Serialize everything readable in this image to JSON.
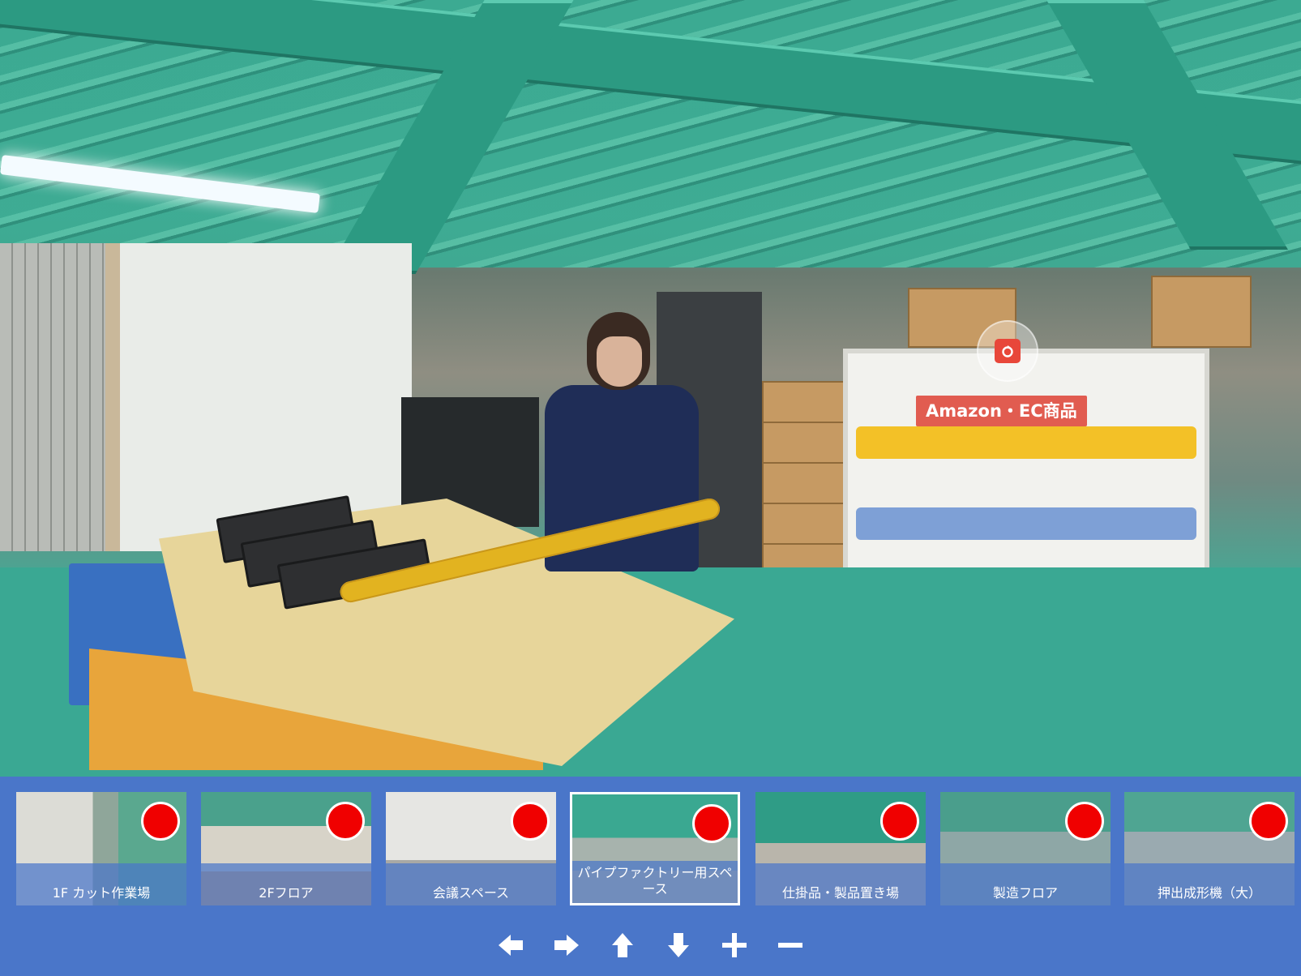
{
  "hotspot": {
    "label": "Amazon・EC商品",
    "icon": "camera-icon"
  },
  "thumbnails": [
    {
      "label": "1F カット作業場",
      "active": false
    },
    {
      "label": "2Fフロア",
      "active": false
    },
    {
      "label": "会議スペース",
      "active": false
    },
    {
      "label": "パイプファクトリー用スペース",
      "active": true
    },
    {
      "label": "仕掛品・製品置き場",
      "active": false
    },
    {
      "label": "製造フロア",
      "active": false
    },
    {
      "label": "押出成形機（大）",
      "active": false
    }
  ],
  "controls": [
    {
      "name": "arrow-left-icon"
    },
    {
      "name": "arrow-right-icon"
    },
    {
      "name": "arrow-up-icon"
    },
    {
      "name": "arrow-down-icon"
    },
    {
      "name": "plus-icon"
    },
    {
      "name": "minus-icon"
    }
  ],
  "colors": {
    "bar": "#4a76c9",
    "dot": "#f00000",
    "hotspot_label_bg": "#e04f42"
  }
}
